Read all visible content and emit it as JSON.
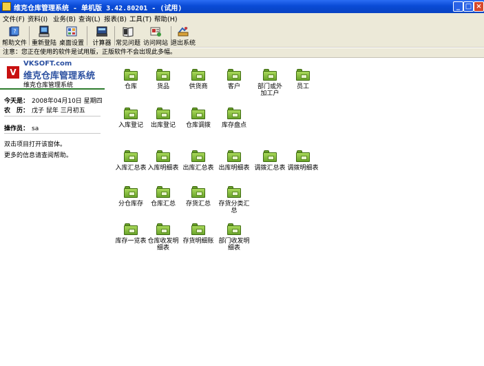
{
  "window": {
    "title": "维克仓库管理系统 - 单机版 3.42.80201 - (试用)",
    "min": "_",
    "max": "□",
    "close": "×"
  },
  "menu": [
    "文件(F)",
    "资料(I)",
    "业务(B)",
    "查询(L)",
    "报表(B)",
    "工具(T)",
    "帮助(H)"
  ],
  "toolbar": [
    {
      "label": "帮助文件",
      "icon": "help-book-icon"
    },
    {
      "label": "重新登陆",
      "icon": "monitor-login-icon"
    },
    {
      "label": "桌面设置",
      "icon": "desktop-settings-icon"
    },
    {
      "label": "计算器",
      "icon": "calculator-icon"
    },
    {
      "label": "常见问题",
      "icon": "faq-book-icon"
    },
    {
      "label": "访问网站",
      "icon": "website-icon"
    },
    {
      "label": "退出系统",
      "icon": "exit-icon"
    }
  ],
  "notice": "注意：您正在使用的软件是试用版，正版软件不会出现此多幅。",
  "brand": {
    "logo": "V",
    "site": "VKSOFT.com",
    "name": "维克仓库管理系统",
    "sub": "维克仓库管理系统"
  },
  "info": {
    "today_label": "今天是：",
    "today_value": "2008年04月10日  星期四",
    "lunar_label": "农　历：",
    "lunar_value": "戊子  鼠年  三月初五",
    "operator_label": "操作员：",
    "operator_value": "sa"
  },
  "help": {
    "line1": "双击项目打开该窗体。",
    "line2": "更多的信息请查阅帮助。"
  },
  "modules": [
    {
      "label": "仓库"
    },
    {
      "label": "货品"
    },
    {
      "label": "供货商"
    },
    {
      "label": "客户"
    },
    {
      "label": "部门或外加工户"
    },
    {
      "label": "员工"
    },
    {
      "label": "入库登记"
    },
    {
      "label": "出库登记"
    },
    {
      "label": "仓库调拨"
    },
    {
      "label": "库存盘点"
    },
    {
      "label": "入库汇总表"
    },
    {
      "label": "入库明细表"
    },
    {
      "label": "出库汇总表"
    },
    {
      "label": "出库明细表"
    },
    {
      "label": "调拨汇总表"
    },
    {
      "label": "调拨明细表"
    },
    {
      "label": "分仓库存"
    },
    {
      "label": "仓库汇总"
    },
    {
      "label": "存货汇总"
    },
    {
      "label": "存货分类汇总"
    },
    {
      "label": "库存一览表"
    },
    {
      "label": "仓库收发明细表"
    },
    {
      "label": "存货明细账"
    },
    {
      "label": "部门收发明细表"
    }
  ]
}
